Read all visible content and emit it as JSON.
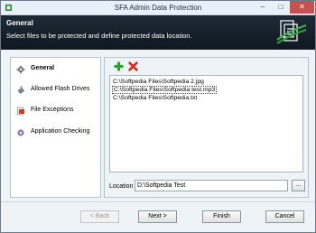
{
  "window": {
    "title": "SFA Admin Data Protection",
    "minimize_glyph": "–",
    "maximize_glyph": "□",
    "close_glyph": "✕"
  },
  "banner": {
    "title": "General",
    "subtitle": "Select files to be protected and define protected data location."
  },
  "nav": {
    "items": [
      {
        "label": "General",
        "icon": "gear-icon"
      },
      {
        "label": "Allowed Flash Drives",
        "icon": "flash-drive-icon"
      },
      {
        "label": "File Exceptions",
        "icon": "file-exception-icon"
      },
      {
        "label": "Application Checking",
        "icon": "app-gear-icon"
      }
    ]
  },
  "toolbar": {
    "add_icon": "add-icon",
    "remove_icon": "remove-icon"
  },
  "files": [
    "C:\\Softpedia Files\\Softpedia 2.jpg",
    "C:\\Softpedia Files\\Softpedia test.mp3",
    "C:\\Softpedia Files\\Softpedia.txt"
  ],
  "location": {
    "label": "Location",
    "value": "D:\\Softpedia Test",
    "browse_label": "..."
  },
  "buttons": {
    "back": "< Back",
    "next": "Next >",
    "finish": "Finish",
    "cancel": "Cancel"
  },
  "colors": {
    "banner_bg": "#18232e",
    "add_green": "#2e9e2e",
    "remove_red": "#d42a1a",
    "close_red": "#c75050"
  }
}
